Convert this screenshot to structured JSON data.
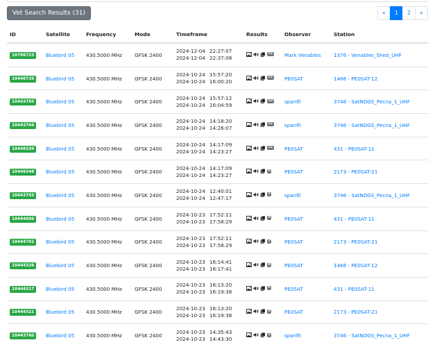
{
  "toolbar": {
    "vet_label": "Vet Search Results (31)"
  },
  "pagination": {
    "prev": "«",
    "pages": [
      "1",
      "2"
    ],
    "next": "»"
  },
  "table": {
    "headers": [
      "ID",
      "Satellite",
      "Frequency",
      "Mode",
      "Timeframe",
      "Results",
      "Observer",
      "Station"
    ],
    "rows": [
      {
        "id": "10706723",
        "satellite": "Bluebird 05",
        "frequency": "430.5000 MHz",
        "mode": "GFSK 2400",
        "start_date": "2024-12-04",
        "start_time": "22:27:07",
        "end_date": "2024-12-04",
        "end_time": "22:37:08",
        "count": "31",
        "observer": "Mark Venables",
        "station": "1376 - Venables_Shed_UHF"
      },
      {
        "id": "10449735",
        "satellite": "Bluebird 05",
        "frequency": "430.5000 MHz",
        "mode": "GFSK 2400",
        "start_date": "2024-10-24",
        "start_time": "15:57:20",
        "end_date": "2024-10-24",
        "end_time": "16:00:20",
        "count": "21",
        "observer": "PE0SAT",
        "station": "1466 - PE0SAT-12"
      },
      {
        "id": "10443765",
        "satellite": "Bluebird 05",
        "frequency": "430.5000 MHz",
        "mode": "GFSK 2400",
        "start_date": "2024-10-24",
        "start_time": "15:57:12",
        "end_date": "2024-10-24",
        "end_time": "16:04:59",
        "count": "13",
        "observer": "spanfil",
        "station": "3746 - SatNOGS_Pecna_1_UHF"
      },
      {
        "id": "10443764",
        "satellite": "Bluebird 05",
        "frequency": "430.5000 MHz",
        "mode": "GFSK 2400",
        "start_date": "2024-10-24",
        "start_time": "14:18:20",
        "end_date": "2024-10-24",
        "end_time": "14:26:07",
        "count": "11",
        "observer": "spanfil",
        "station": "3746 - SatNOGS_Pecna_1_UHF"
      },
      {
        "id": "10449339",
        "satellite": "Bluebird 05",
        "frequency": "430.5000 MHz",
        "mode": "GFSK 2400",
        "start_date": "2024-10-24",
        "start_time": "14:17:09",
        "end_date": "2024-10-24",
        "end_time": "14:23:27",
        "count": "11",
        "observer": "PE0SAT",
        "station": "431 - PE0SAT-11"
      },
      {
        "id": "10449348",
        "satellite": "Bluebird 05",
        "frequency": "430.5000 MHz",
        "mode": "GFSK 2400",
        "start_date": "2024-10-24",
        "start_time": "14:17:09",
        "end_date": "2024-10-24",
        "end_time": "14:23:27",
        "count": "6",
        "observer": "PE0SAT",
        "station": "2173 - PE0SAT-21"
      },
      {
        "id": "10443763",
        "satellite": "Bluebird 05",
        "frequency": "430.5000 MHz",
        "mode": "GFSK 2400",
        "start_date": "2024-10-24",
        "start_time": "12:40:01",
        "end_date": "2024-10-24",
        "end_time": "12:47:17",
        "count": "1",
        "observer": "spanfil",
        "station": "3746 - SatNOGS_Pecna_1_UHF"
      },
      {
        "id": "10444696",
        "satellite": "Bluebird 05",
        "frequency": "430.5000 MHz",
        "mode": "GFSK 2400",
        "start_date": "2024-10-23",
        "start_time": "17:52:11",
        "end_date": "2024-10-23",
        "end_time": "17:58:29",
        "count": "9",
        "observer": "PE0SAT",
        "station": "431 - PE0SAT-11"
      },
      {
        "id": "10444701",
        "satellite": "Bluebird 05",
        "frequency": "430.5000 MHz",
        "mode": "GFSK 2400",
        "start_date": "2024-10-23",
        "start_time": "17:52:11",
        "end_date": "2024-10-23",
        "end_time": "17:58:29",
        "count": "2",
        "observer": "PE0SAT",
        "station": "2173 - PE0SAT-21"
      },
      {
        "id": "10444326",
        "satellite": "Bluebird 05",
        "frequency": "430.5000 MHz",
        "mode": "GFSK 2400",
        "start_date": "2024-10-23",
        "start_time": "16:14:41",
        "end_date": "2024-10-23",
        "end_time": "16:17:41",
        "count": "8",
        "observer": "PE0SAT",
        "station": "1466 - PE0SAT-12"
      },
      {
        "id": "10444317",
        "satellite": "Bluebird 05",
        "frequency": "430.5000 MHz",
        "mode": "GFSK 2400",
        "start_date": "2024-10-23",
        "start_time": "16:13:20",
        "end_date": "2024-10-23",
        "end_time": "16:19:38",
        "count": "6",
        "observer": "PE0SAT",
        "station": "431 - PE0SAT-11"
      },
      {
        "id": "10444321",
        "satellite": "Bluebird 05",
        "frequency": "430.5000 MHz",
        "mode": "GFSK 2400",
        "start_date": "2024-10-23",
        "start_time": "16:13:20",
        "end_date": "2024-10-23",
        "end_time": "16:19:38",
        "count": "9",
        "observer": "PE0SAT",
        "station": "2173 - PE0SAT-21"
      },
      {
        "id": "10443760",
        "satellite": "Bluebird 05",
        "frequency": "430.5000 MHz",
        "mode": "GFSK 2400",
        "start_date": "2024-10-23",
        "start_time": "14:35:43",
        "end_date": "2024-10-23",
        "end_time": "14:43:30",
        "count": "1",
        "observer": "spanfil",
        "station": "3746 - SatNOGS_Pecna_1_UHF"
      }
    ]
  },
  "icons": [
    "image-icon",
    "audio-icon",
    "data-icon"
  ],
  "colors": {
    "badge": "#28a745",
    "link": "#007bff",
    "vet_button": "#6c757d",
    "active_page": "#007bff"
  }
}
